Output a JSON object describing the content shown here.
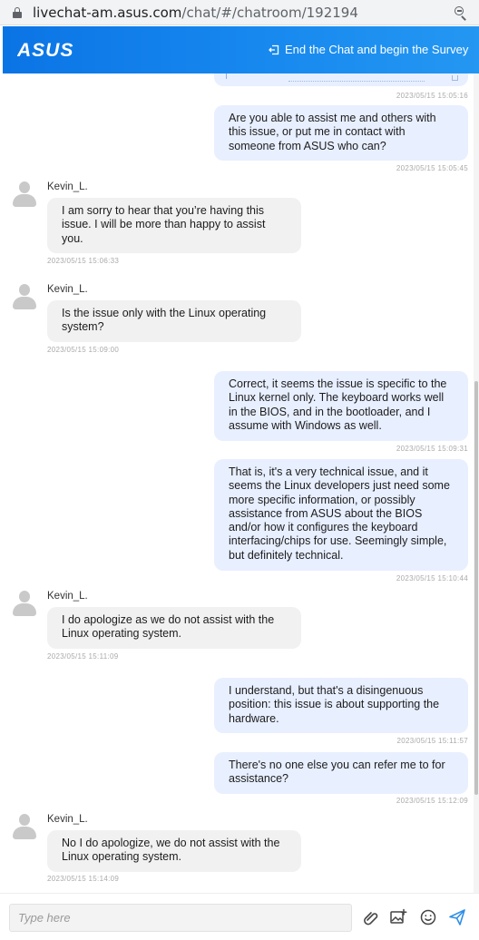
{
  "browser": {
    "url_host": "livechat-am.asus.com",
    "url_path": "/chat/#/chatroom/192194"
  },
  "header": {
    "logo_text": "ASUS",
    "end_chat_label": "End the Chat and begin the Survey"
  },
  "chat": {
    "agent_name": "Kevin_L.",
    "messages": [
      {
        "from": "user",
        "text": "",
        "time": "2023/05/15 15:05:16"
      },
      {
        "from": "user",
        "text": "Are you able to assist me and others with this issue, or put me in contact with someone from ASUS who can?",
        "time": "2023/05/15 15:05:45"
      },
      {
        "from": "agent",
        "name": "Kevin_L.",
        "text": "I am sorry to hear that you’re having this issue. I will be more than happy to assist you.",
        "time": "2023/05/15 15:06:33"
      },
      {
        "from": "agent",
        "name": "Kevin_L.",
        "text": "Is the issue only with the Linux operating system?",
        "time": "2023/05/15 15:09:00"
      },
      {
        "from": "user",
        "text": "Correct, it seems the issue is specific to the Linux kernel only.  The keyboard works well in the BIOS, and in the bootloader, and I assume with Windows as well.",
        "time": "2023/05/15 15:09:31"
      },
      {
        "from": "user",
        "text": "That is, it's a very technical issue, and it seems the Linux developers just need some more specific information, or possibly assistance from ASUS about the BIOS and/or how it configures the keyboard interfacing/chips for use.  Seemingly simple, but definitely technical.",
        "time": "2023/05/15 15:10:44"
      },
      {
        "from": "agent",
        "name": "Kevin_L.",
        "text": "I do apologize as we do not assist with the Linux operating system.",
        "time": "2023/05/15 15:11:09"
      },
      {
        "from": "user",
        "text": "I understand, but that's a disingenuous position: this issue is about supporting the hardware.",
        "time": "2023/05/15 15:11:57"
      },
      {
        "from": "user",
        "text": "There's no one else you can refer me to for assistance?",
        "time": "2023/05/15 15:12:09"
      },
      {
        "from": "agent",
        "name": "Kevin_L.",
        "text": "No I do apologize, we do not assist with the Linux operating system.",
        "time": "2023/05/15 15:14:09"
      }
    ]
  },
  "composer": {
    "placeholder": "Type here",
    "icons": [
      "paperclip-icon",
      "image-upload-icon",
      "emoji-icon",
      "send-icon"
    ]
  },
  "colors": {
    "header_blue": "#0b74e5",
    "user_bubble": "#e8efff",
    "agent_bubble": "#f1f1f1",
    "send_icon": "#2f8fe6"
  }
}
